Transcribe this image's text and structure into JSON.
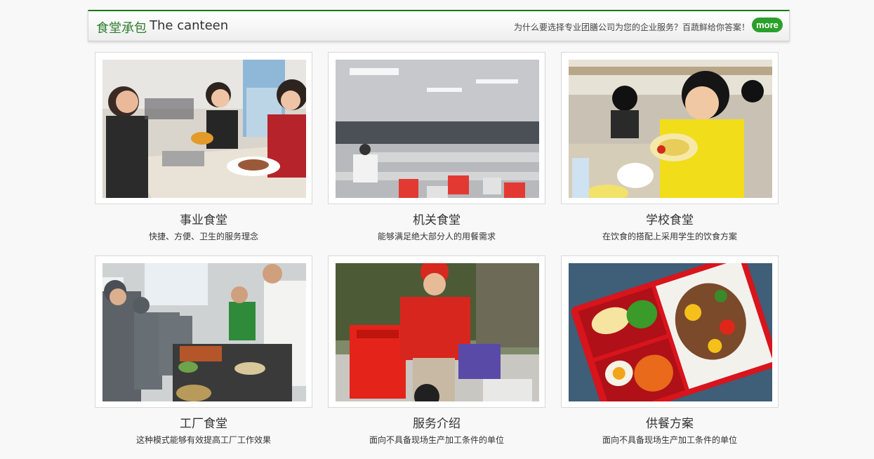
{
  "header": {
    "title_cn": "食堂承包",
    "title_en": "The canteen",
    "tagline": "为什么要选择专业团膳公司为您的企业服务？百蔬鲜给你答案！",
    "more_label": "more"
  },
  "cards": [
    {
      "title": "事业食堂",
      "desc": "快捷、方便、卫生的服务理念"
    },
    {
      "title": "机关食堂",
      "desc": "能够满足绝大部分人的用餐需求"
    },
    {
      "title": "学校食堂",
      "desc": "在饮食的搭配上采用学生的饮食方案"
    },
    {
      "title": "工厂食堂",
      "desc": "这种模式能够有效提高工厂工作效果"
    },
    {
      "title": "服务介绍",
      "desc": "面向不具备现场生产加工条件的单位"
    },
    {
      "title": "供餐方案",
      "desc": "面向不具备现场生产加工条件的单位"
    }
  ],
  "colors": {
    "accent_green": "#2d7d2d",
    "more_button": "#2aa02a"
  }
}
